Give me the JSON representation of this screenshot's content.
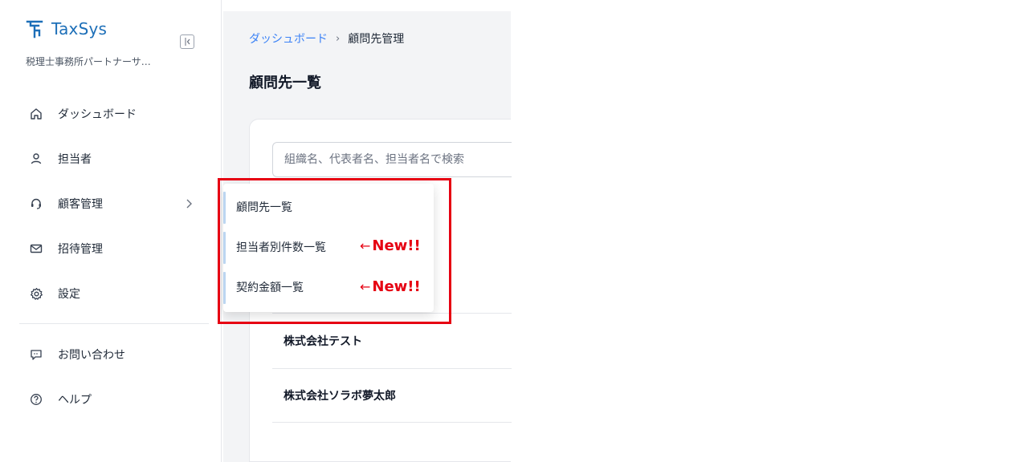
{
  "brand": {
    "name": "TaxSys",
    "org": "税理士事務所パートナーサ…"
  },
  "sidebar": {
    "items": [
      {
        "label": "ダッシュボード",
        "icon": "home-icon"
      },
      {
        "label": "担当者",
        "icon": "user-icon"
      },
      {
        "label": "顧客管理",
        "icon": "headset-icon"
      },
      {
        "label": "招待管理",
        "icon": "mail-icon"
      },
      {
        "label": "設定",
        "icon": "gear-icon"
      }
    ],
    "bottom_items": [
      {
        "label": "お問い合わせ",
        "icon": "chat-icon"
      },
      {
        "label": "ヘルプ",
        "icon": "help-icon"
      }
    ]
  },
  "breadcrumb": {
    "parent": "ダッシュボード",
    "separator": "›",
    "current": "顧問先管理"
  },
  "page": {
    "title": "顧問先一覧"
  },
  "search": {
    "placeholder": "組織名、代表者名、担当者名で検索"
  },
  "table": {
    "rows": [
      {
        "name": "株式会社テスト"
      },
      {
        "name": "株式会社ソラボ夢太郎"
      }
    ]
  },
  "submenu": {
    "items": [
      {
        "label": "顧問先一覧"
      },
      {
        "label": "担当者別件数一覧"
      },
      {
        "label": "契約金額一覧"
      }
    ]
  },
  "annotation": {
    "arrow": "←",
    "text": "New!!"
  },
  "colors": {
    "accent": "#1d6fb8",
    "link": "#3b82f6",
    "highlight": "#e60012"
  }
}
